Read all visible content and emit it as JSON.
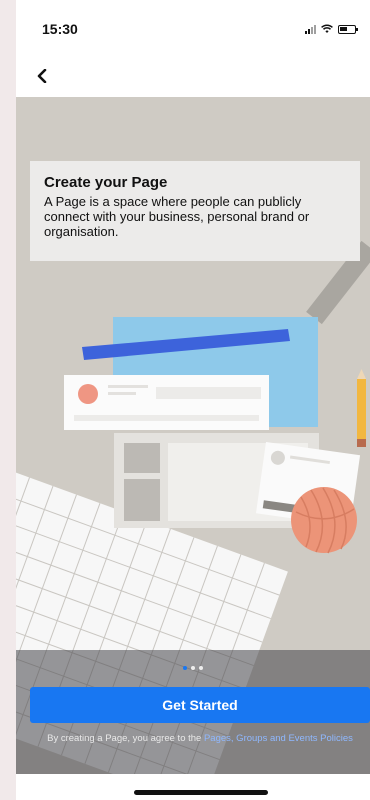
{
  "status_bar": {
    "time": "15:30"
  },
  "nav": {
    "back_icon": "chevron-left-icon"
  },
  "intro": {
    "title": "Create your Page",
    "description": "A Page is a space where people can publicly connect with your business, personal brand or organisation."
  },
  "carousel": {
    "page_count": 3,
    "active_index": 0
  },
  "actions": {
    "get_started_label": "Get Started"
  },
  "legal": {
    "prefix": "By creating a Page, you agree to the ",
    "link": "Pages, Groups and Events Policies"
  },
  "colors": {
    "accent": "#1877f2",
    "illustration_bg": "#cfcbc4"
  }
}
